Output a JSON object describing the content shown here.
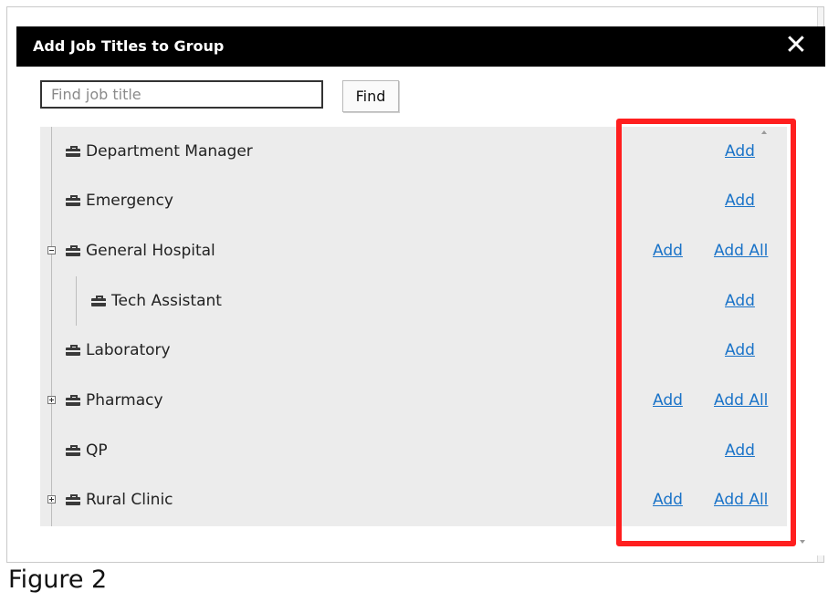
{
  "dialog": {
    "title": "Add Job Titles to Group",
    "close_label": "✕"
  },
  "search": {
    "placeholder": "Find job title",
    "value": "",
    "find_label": "Find"
  },
  "tree": {
    "items": [
      {
        "label": "Department Manager",
        "expander": null,
        "add": "Add",
        "add_all": null
      },
      {
        "label": "Emergency",
        "expander": null,
        "add": "Add",
        "add_all": null
      },
      {
        "label": "General Hospital",
        "expander": "collapse",
        "add": "Add",
        "add_all": "Add All"
      },
      {
        "label": "Tech Assistant",
        "expander": null,
        "add": "Add",
        "add_all": null,
        "child": true
      },
      {
        "label": "Laboratory",
        "expander": null,
        "add": "Add",
        "add_all": null
      },
      {
        "label": "Pharmacy",
        "expander": "expand",
        "add": "Add",
        "add_all": "Add All"
      },
      {
        "label": "QP",
        "expander": null,
        "add": "Add",
        "add_all": null
      },
      {
        "label": "Rural Clinic",
        "expander": "expand",
        "add": "Add",
        "add_all": "Add All"
      }
    ]
  },
  "icons": {
    "job": "briefcase-icon",
    "close": "close-icon",
    "expand": "plus-box-icon",
    "collapse": "minus-box-icon"
  },
  "colors": {
    "titlebar": "#000000",
    "link": "#1a73c8",
    "highlight": "#ff1f1f",
    "tree_bg": "#ececec"
  },
  "caption": "Figure 2"
}
